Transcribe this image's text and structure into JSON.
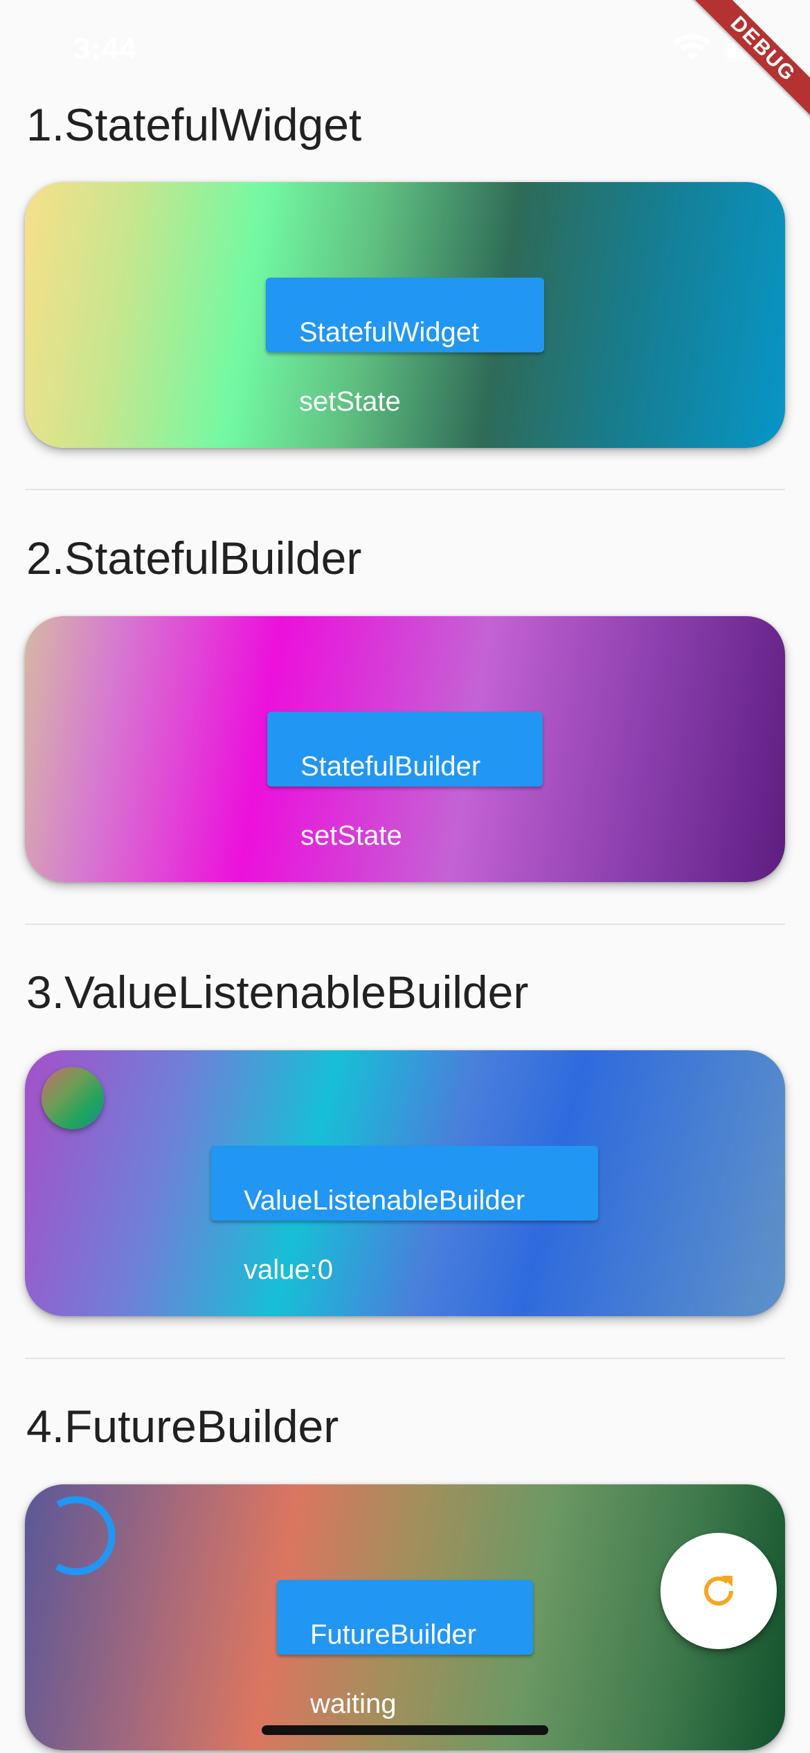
{
  "status_bar": {
    "time": "3:44"
  },
  "debug_banner": {
    "label": "DEBUG"
  },
  "sections": [
    {
      "title": "1.StatefulWidget",
      "button_line1": "StatefulWidget",
      "button_line2": "setState"
    },
    {
      "title": "2.StatefulBuilder",
      "button_line1": "StatefulBuilder",
      "button_line2": "setState"
    },
    {
      "title": "3.ValueListenableBuilder",
      "button_line1": "ValueListenableBuilder",
      "button_line2": "value:0"
    },
    {
      "title": "4.FutureBuilder",
      "button_line1": "FutureBuilder",
      "button_line2": "waiting"
    }
  ],
  "icons": {
    "wifi": "wifi-icon",
    "battery": "battery-icon",
    "spinner": "loading-spinner-icon",
    "fab": "refresh-icon"
  },
  "colors": {
    "button": "#2196f3",
    "fab_icon": "#f5a623",
    "spinner": "#2196f3",
    "debug": "#b43232"
  }
}
